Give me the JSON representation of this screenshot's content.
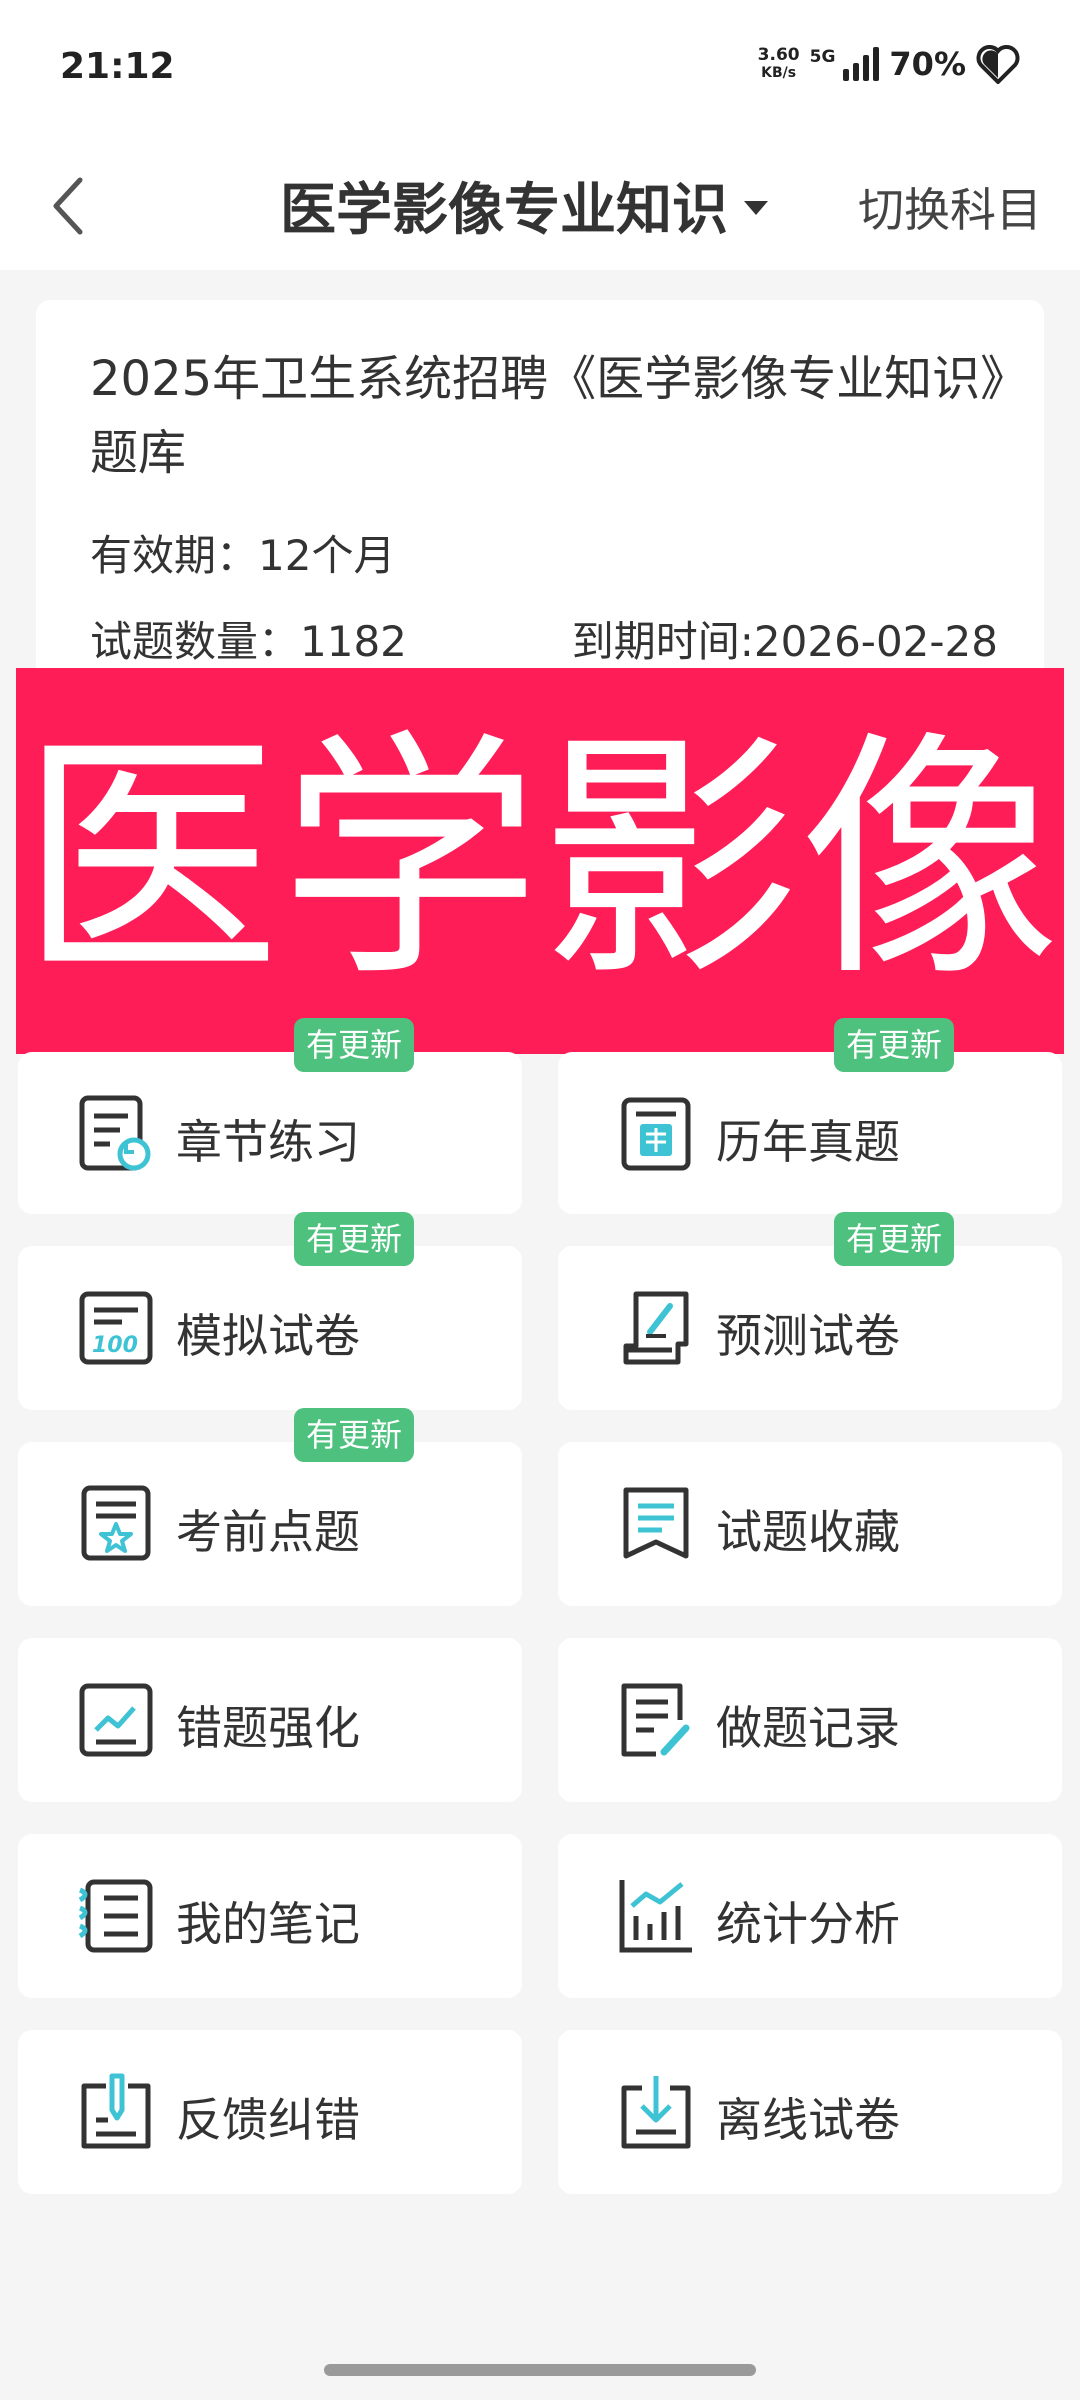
{
  "status": {
    "time": "21:12",
    "net_speed_value": "3.60",
    "net_speed_unit": "KB/s",
    "network": "5G",
    "battery": "70%"
  },
  "nav": {
    "title": "医学影像专业知识",
    "switch_label": "切换科目"
  },
  "info": {
    "title": "2025年卫生系统招聘《医学影像专业知识》题库",
    "validity": "有效期：12个月",
    "question_count": "试题数量：1182",
    "expiry": "到期时间:2026-02-28"
  },
  "banner": {
    "text": "医学影像",
    "color": "#ff1d58"
  },
  "accent_color": "#3ec3d5",
  "badge_color": "#4ec17e",
  "tiles": [
    {
      "label": "章节练习",
      "badge": "有更新",
      "icon": "chapter-practice-icon"
    },
    {
      "label": "历年真题",
      "badge": "有更新",
      "icon": "past-exams-icon"
    },
    {
      "label": "模拟试卷",
      "badge": "有更新",
      "icon": "mock-exam-icon"
    },
    {
      "label": "预测试卷",
      "badge": "有更新",
      "icon": "forecast-exam-icon"
    },
    {
      "label": "考前点题",
      "badge": "有更新",
      "icon": "pre-exam-tips-icon"
    },
    {
      "label": "试题收藏",
      "icon": "bookmark-icon"
    },
    {
      "label": "错题强化",
      "icon": "wrong-questions-icon"
    },
    {
      "label": "做题记录",
      "icon": "practice-record-icon"
    },
    {
      "label": "我的笔记",
      "icon": "notes-icon"
    },
    {
      "label": "统计分析",
      "icon": "statistics-icon"
    },
    {
      "label": "反馈纠错",
      "icon": "feedback-icon"
    },
    {
      "label": "离线试卷",
      "icon": "offline-download-icon"
    }
  ]
}
